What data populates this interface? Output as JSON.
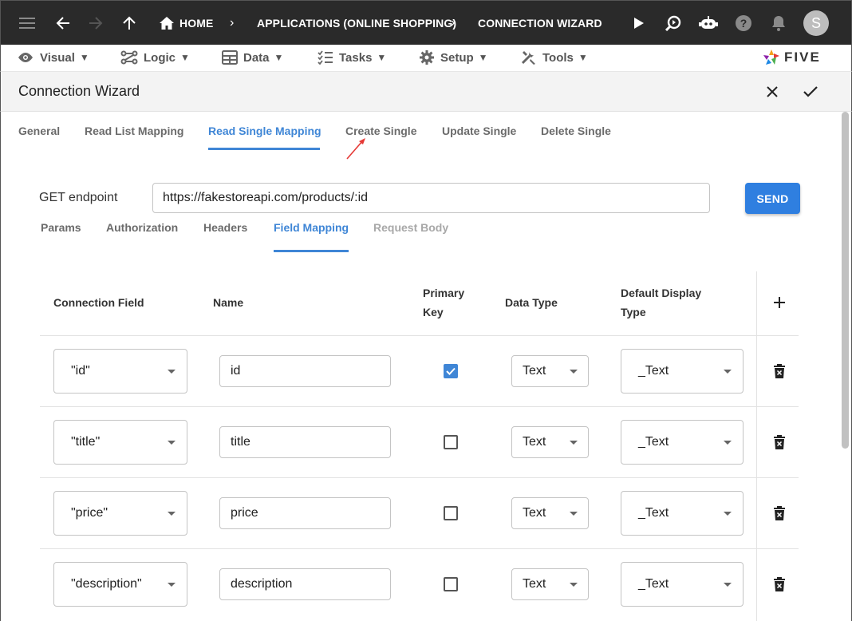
{
  "topbar": {
    "breadcrumb": [
      "HOME",
      "APPLICATIONS (ONLINE SHOPPING)",
      "CONNECTION WIZARD"
    ],
    "avatar_letter": "S",
    "icons": [
      "menu-icon",
      "arrow-back-icon",
      "arrow-forward-icon",
      "arrow-up-icon",
      "home-icon",
      "play-icon",
      "search-icon",
      "chat-bot-icon",
      "help-icon",
      "bell-icon"
    ]
  },
  "menubar": {
    "items": [
      {
        "label": "Visual",
        "icon": "eye-icon"
      },
      {
        "label": "Logic",
        "icon": "logic-icon"
      },
      {
        "label": "Data",
        "icon": "table-icon"
      },
      {
        "label": "Tasks",
        "icon": "tasks-icon"
      },
      {
        "label": "Setup",
        "icon": "gear-icon"
      },
      {
        "label": "Tools",
        "icon": "tools-icon"
      }
    ],
    "caret": "▼",
    "logo_text": "FIVE"
  },
  "header": {
    "title": "Connection Wizard"
  },
  "tabs": [
    "General",
    "Read List Mapping",
    "Read Single Mapping",
    "Create Single",
    "Update Single",
    "Delete Single"
  ],
  "active_tab": "Read Single Mapping",
  "request": {
    "method_label": "GET endpoint",
    "url": "https://fakestoreapi.com/products/:id",
    "send_label": "SEND"
  },
  "subtabs": [
    "Params",
    "Authorization",
    "Headers",
    "Field Mapping",
    "Request Body"
  ],
  "active_subtab": "Field Mapping",
  "table": {
    "headers": {
      "connection_field": "Connection Field",
      "name": "Name",
      "primary_key_1": "Primary",
      "primary_key_2": "Key",
      "data_type": "Data Type",
      "display_type_1": "Default Display",
      "display_type_2": "Type"
    },
    "rows": [
      {
        "connection_field": "\"id\"",
        "name": "id",
        "primary_key": true,
        "data_type": "Text",
        "display_type": "_Text"
      },
      {
        "connection_field": "\"title\"",
        "name": "title",
        "primary_key": false,
        "data_type": "Text",
        "display_type": "_Text"
      },
      {
        "connection_field": "\"price\"",
        "name": "price",
        "primary_key": false,
        "data_type": "Text",
        "display_type": "_Text"
      },
      {
        "connection_field": "\"description\"",
        "name": "description",
        "primary_key": false,
        "data_type": "Text",
        "display_type": "_Text"
      }
    ]
  },
  "colors": {
    "accent": "#3f86d6",
    "send": "#2f7fe0",
    "topbar": "#2a2a2a",
    "annotation_arrow": "#e53935"
  }
}
